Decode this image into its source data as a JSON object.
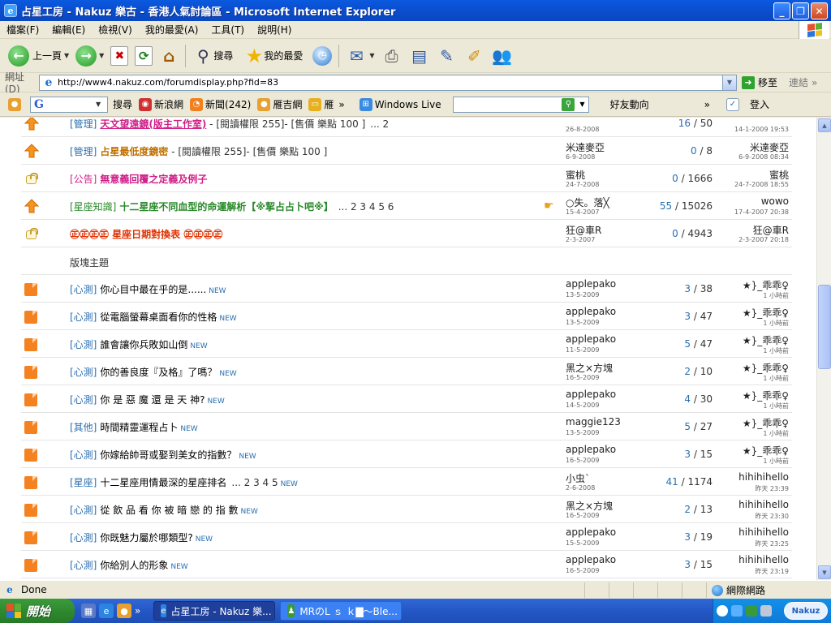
{
  "window": {
    "title": "占星工房 - Nakuz 樂古 - 香港人氣討論區 - Microsoft Internet Explorer",
    "app_icon": "e-icon",
    "colors": {
      "titlebar": "#0a5ae0",
      "accent_blue": "#2a6fb0",
      "orange_doc": "#f58220"
    }
  },
  "menu": [
    "檔案(F)",
    "編輯(E)",
    "檢視(V)",
    "我的最愛(A)",
    "工具(T)",
    "說明(H)"
  ],
  "toolbar": {
    "back_label": "上一頁",
    "search_label": "搜尋",
    "favorites_label": "我的最愛"
  },
  "address": {
    "label": "網址(D)",
    "url": "http://www4.nakuz.com/forumdisplay.php?fid=83",
    "go_label": "移至",
    "links_label": "連結"
  },
  "linksbar": {
    "search_label": "搜尋",
    "sina": "新浪網",
    "news": "新聞(242)",
    "yahoo": "雁吉網",
    "more": "雁",
    "live_label": "Windows Live",
    "friends": "好友動向",
    "login": "登入",
    "g_logo": "G"
  },
  "forum": {
    "section_label": "版塊主題",
    "rows": [
      {
        "type": "up",
        "prefix": "[管理]",
        "title": "天文望遠鏡(版主工作室)",
        "extra": " - [閱讀權限 255]- [售價 樂點 100 ]",
        "pages": "... 2",
        "author": "",
        "adate": "26-8-2008",
        "replies": "16",
        "views": "50",
        "last": "",
        "ldate": "14-1-2009 19:53",
        "partial": true
      },
      {
        "type": "up",
        "prefix": "[管理]",
        "title": "占星最低度鏡密",
        "extra": " - [閱讀權限 255]- [售價 樂點 100 ]",
        "pages": "",
        "author": "米達麥亞",
        "adate": "6-9-2008",
        "replies": "0",
        "views": "8",
        "last": "米達麥亞",
        "ldate": "6-9-2008 08:34"
      },
      {
        "type": "lock",
        "prefix": "[公告]",
        "title": "無意義回覆之定義及例子",
        "extra": "",
        "pages": "",
        "author": "蜜桃",
        "adate": "24-7-2008",
        "replies": "0",
        "views": "1666",
        "last": "蜜桃",
        "ldate": "24-7-2008 18:55"
      },
      {
        "type": "up",
        "prefix": "[星座知識]",
        "title": "十二星座不同血型的命運解析【※挈占占卜吧※】",
        "extra": "",
        "pages": "... 2 3 4 5 6",
        "hand": true,
        "author": "○失。落╳",
        "adate": "15-4-2007",
        "replies": "55",
        "views": "15026",
        "last": "wowo",
        "ldate": "17-4-2007 20:38"
      },
      {
        "type": "lock",
        "prefix": "",
        "title": "㊣㊣㊣㊣ 星座日期對換表 ㊣㊣㊣㊣",
        "extra": "",
        "pages": "",
        "author": "狂@車R",
        "adate": "2-3-2007",
        "replies": "0",
        "views": "4943",
        "last": "狂@車R",
        "ldate": "2-3-2007 20:18",
        "red": true
      },
      {
        "type": "doc",
        "prefix": "[心測]",
        "title": "你心目中最在乎的是......",
        "new": "NEW",
        "author": "applepako",
        "adate": "13-5-2009",
        "replies": "3",
        "views": "38",
        "last": "★}_乖乖♀",
        "ldate": "1 小時前"
      },
      {
        "type": "doc",
        "prefix": "[心測]",
        "title": "從電腦螢幕桌面看你的性格",
        "new": "NEW",
        "author": "applepako",
        "adate": "13-5-2009",
        "replies": "3",
        "views": "47",
        "last": "★}_乖乖♀",
        "ldate": "1 小時前"
      },
      {
        "type": "doc",
        "prefix": "[心測]",
        "title": "誰會讓你兵敗如山倒",
        "new": "NEW",
        "author": "applepako",
        "adate": "11-5-2009",
        "replies": "5",
        "views": "47",
        "last": "★}_乖乖♀",
        "ldate": "1 小時前"
      },
      {
        "type": "doc",
        "prefix": "[心測]",
        "title": "你的善良度『及格』了嗎？",
        "new": "NEW",
        "author": "黑之×方塊",
        "adate": "16-5-2009",
        "replies": "2",
        "views": "10",
        "last": "★}_乖乖♀",
        "ldate": "1 小時前"
      },
      {
        "type": "doc",
        "prefix": "[心測]",
        "title": "你 是 惡 魔 還 是 天 神?",
        "new": "NEW",
        "author": "applepako",
        "adate": "14-5-2009",
        "replies": "4",
        "views": "30",
        "last": "★}_乖乖♀",
        "ldate": "1 小時前"
      },
      {
        "type": "doc",
        "prefix": "[其他]",
        "title": "時間精靈運程占卜",
        "new": "NEW",
        "author": "maggie123",
        "adate": "13-5-2009",
        "replies": "5",
        "views": "27",
        "last": "★}_乖乖♀",
        "ldate": "1 小時前"
      },
      {
        "type": "doc",
        "prefix": "[心測]",
        "title": "你嫁給帥哥或娶到美女的指數？",
        "new": "NEW",
        "author": "applepako",
        "adate": "16-5-2009",
        "replies": "3",
        "views": "15",
        "last": "★}_乖乖♀",
        "ldate": "1 小時前"
      },
      {
        "type": "doc",
        "prefix": "[星座]",
        "title": "十二星座用情最深的星座排名",
        "pages": "... 2 3 4 5",
        "new": "NEW",
        "author": "小虫`",
        "adate": "2-6-2008",
        "replies": "41",
        "views": "1174",
        "last": "hihihihello",
        "ldate": "昨天 23:39"
      },
      {
        "type": "doc",
        "prefix": "[心測]",
        "title": "從 飲 品 看 你 被 暗 戀 的 指 數",
        "new": "NEW",
        "author": "黑之×方塊",
        "adate": "16-5-2009",
        "replies": "2",
        "views": "13",
        "last": "hihihihello",
        "ldate": "昨天 23:30"
      },
      {
        "type": "doc",
        "prefix": "[心測]",
        "title": "你既魅力屬於哪類型?",
        "new": "NEW",
        "author": "applepako",
        "adate": "15-5-2009",
        "replies": "3",
        "views": "19",
        "last": "hihihihello",
        "ldate": "昨天 23:25"
      },
      {
        "type": "doc",
        "prefix": "[心測]",
        "title": "你給別人的形象",
        "new": "NEW",
        "author": "applepako",
        "adate": "16-5-2009",
        "replies": "3",
        "views": "15",
        "last": "hihihihello",
        "ldate": "昨天 23:19"
      }
    ]
  },
  "status": {
    "text": "Done",
    "zone": "網際網路"
  },
  "taskbar": {
    "start": "開始",
    "tasks": [
      "占星工房 - Nakuz 樂...",
      "MRのL ｓ ｋ▇〜Ble..."
    ],
    "tray_logo": "Nakuz"
  }
}
